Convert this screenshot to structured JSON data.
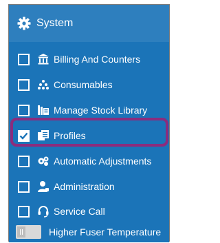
{
  "header": {
    "title": "System",
    "icon": "gear-icon"
  },
  "items": [
    {
      "label": "Billing And Counters",
      "icon": "bank-icon",
      "checked": false
    },
    {
      "label": "Consumables",
      "icon": "dots-icon",
      "checked": false
    },
    {
      "label": "Manage Stock Library",
      "icon": "library-icon",
      "checked": false
    },
    {
      "label": "Profiles",
      "icon": "copy-icon",
      "checked": true
    },
    {
      "label": "Automatic Adjustments",
      "icon": "adjust-icon",
      "checked": false
    },
    {
      "label": "Administration",
      "icon": "user-icon",
      "checked": false
    },
    {
      "label": "Service Call",
      "icon": "headset-icon",
      "checked": false
    }
  ],
  "toggle": {
    "label": "Higher Fuser Temperature",
    "on": false
  },
  "colors": {
    "header": "#2e7fbe",
    "list": "#1b74b8",
    "highlight": "#8b2c7d"
  }
}
